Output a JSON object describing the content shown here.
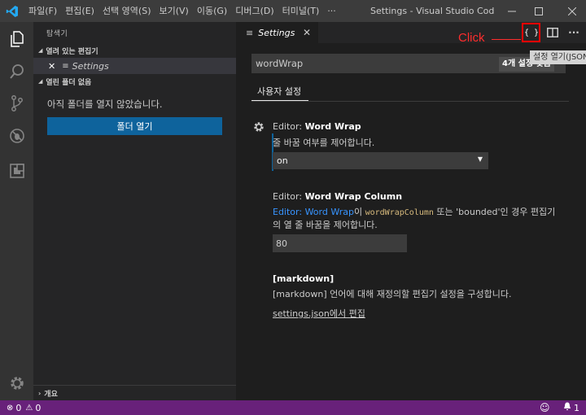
{
  "titlebar": {
    "menu": [
      "파일(F)",
      "편집(E)",
      "선택 영역(S)",
      "보기(V)",
      "이동(G)",
      "디버그(D)",
      "터미널(T)",
      "···"
    ],
    "window_title": "Settings - Visual Studio Code [관리자]"
  },
  "sidebar": {
    "title": "탐색기",
    "open_editors_header": "열려 있는 편집기",
    "open_editor_item": "Settings",
    "no_folder_header": "열린 폴더 없음",
    "empty_message": "아직 폴더를 열지 않았습니다.",
    "open_folder_button": "폴더 열기",
    "outline_header": "개요"
  },
  "editor": {
    "tab_label": "Settings",
    "search_value": "wordWrap",
    "search_count": "4개 설정 찾음",
    "settings_tab": "사용자 설정",
    "tooltip": "설정 열기(JSON)",
    "click_annotation": "Click",
    "word_wrap": {
      "category": "Editor: ",
      "name": "Word Wrap",
      "description": "줄 바꿈 여부를 제어합니다.",
      "value": "on"
    },
    "word_wrap_column": {
      "category": "Editor: ",
      "name": "Word Wrap Column",
      "desc_link": "Editor: Word Wrap",
      "desc_part1": "이 ",
      "desc_code": "wordWrapColumn",
      "desc_part2": " 또는 'bounded'인 경우 편집기",
      "desc_line2": "의 열 줄 바꿈을 제어합니다.",
      "value": "80"
    },
    "markdown": {
      "name": "[markdown]",
      "description": "[markdown] 언어에 대해 재정의할 편집기 설정을 구성합니다.",
      "link": "settings.json에서 편집"
    }
  },
  "statusbar": {
    "errors": "0",
    "warnings": "0",
    "notifications": "1"
  },
  "colors": {
    "statusbar": "#68217a",
    "button": "#0e639c",
    "link": "#3794ff",
    "highlight": "#ff0000"
  }
}
